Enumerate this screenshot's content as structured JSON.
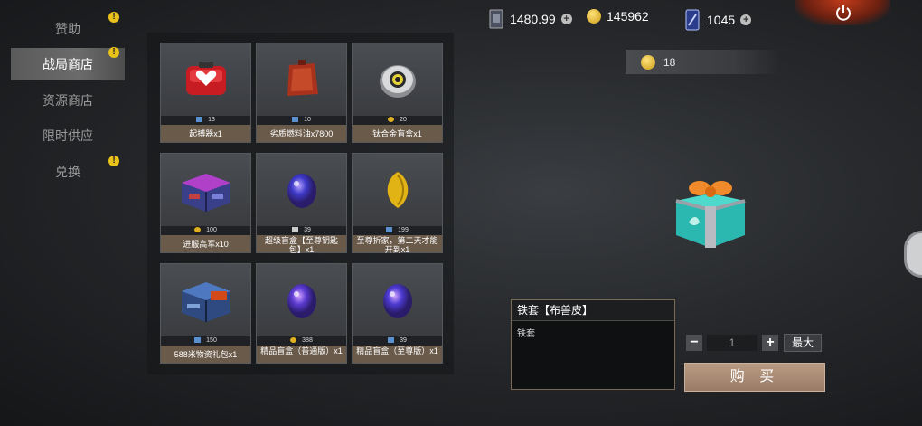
{
  "sidebar": {
    "items": [
      {
        "label": "赞助",
        "active": false,
        "alert": true
      },
      {
        "label": "战局商店",
        "active": true,
        "alert": true
      },
      {
        "label": "资源商店",
        "active": false,
        "alert": false
      },
      {
        "label": "限时供应",
        "active": false,
        "alert": false
      },
      {
        "label": "兑换",
        "active": false,
        "alert": true
      }
    ]
  },
  "currency": {
    "card_value": "1480.99",
    "coins": "145962",
    "tickets": "1045"
  },
  "items": [
    {
      "name": "起搏器x1",
      "price": "13",
      "price_icon": "flag-icon",
      "art": "defibrillator"
    },
    {
      "name": "劣质燃料油x7800",
      "price": "10",
      "price_icon": "flag-icon",
      "art": "fuel-can"
    },
    {
      "name": "钛合金盲盒x1",
      "price": "20",
      "price_icon": "coin-icon",
      "art": "disc"
    },
    {
      "name": "进服高军x10",
      "price": "100",
      "price_icon": "coin-icon",
      "art": "crate-purple"
    },
    {
      "name": "超级盲盒【至尊钥匙包】x1",
      "price": "39",
      "price_icon": "ticket-icon",
      "art": "egg-blue"
    },
    {
      "name": "至尊折家，第二天才能开到x1",
      "price": "199",
      "price_icon": "flag-icon",
      "art": "gold-leaf"
    },
    {
      "name": "588米物资礼包x1",
      "price": "150",
      "price_icon": "flag-icon",
      "art": "crate-blue"
    },
    {
      "name": "精品盲盒（普通版）x1",
      "price": "388",
      "price_icon": "coin-icon",
      "art": "egg-blue"
    },
    {
      "name": "精品盲盒（至尊版）x1",
      "price": "39",
      "price_icon": "flag-icon",
      "art": "egg-blue"
    }
  ],
  "detail": {
    "price": "18",
    "title": "铁套【布兽皮】",
    "description": "铁套",
    "quantity": "1",
    "max_label": "最大",
    "buy_label": "购 买",
    "minus": "−",
    "plus": "+"
  },
  "colors": {
    "accent_gold": "#e8c11a",
    "name_bar": "#6a5a4a",
    "buy_button": "#a88a74"
  }
}
